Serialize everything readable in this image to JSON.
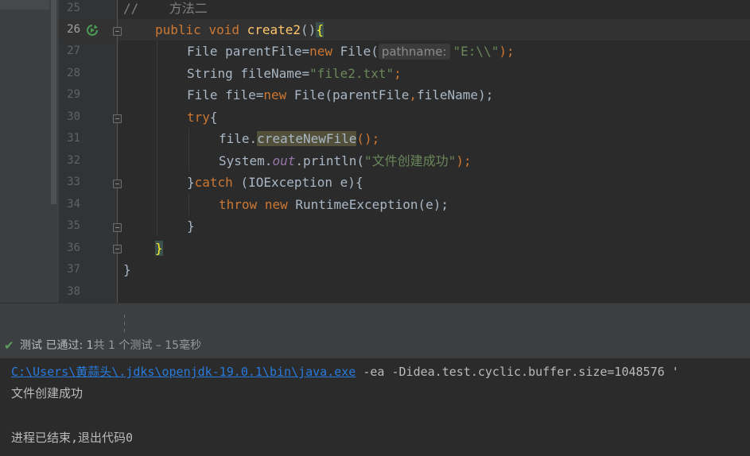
{
  "editor": {
    "lines": [
      {
        "num": "25",
        "comment": "//    方法二"
      },
      {
        "num": "26",
        "kw1": "public",
        "kw2": "void",
        "method": "create2",
        "parens": "()",
        "brace": "{"
      },
      {
        "num": "27",
        "t1": "File parentFile=",
        "kw": "new",
        "t2": " File(",
        "hint": "pathname:",
        "str": "\"E:\\\\\"",
        "t3": ");"
      },
      {
        "num": "28",
        "t1": "String fileName=",
        "str": "\"file2.txt\"",
        "t2": ";"
      },
      {
        "num": "29",
        "t1": "File file=",
        "kw": "new",
        "t2": " File(parentFile",
        "comma": ",",
        "t3": "fileName);"
      },
      {
        "num": "30",
        "kw": "try",
        "t1": "{"
      },
      {
        "num": "31",
        "t1": "file.",
        "hl": "createNewFile",
        "t2": "();"
      },
      {
        "num": "32",
        "t1": "System.",
        "static": "out",
        "t2": ".println(",
        "str": "\"文件创建成功\"",
        "t3": ");"
      },
      {
        "num": "33",
        "t1": "}",
        "kw": "catch",
        "t2": " (IOException e){"
      },
      {
        "num": "34",
        "kw1": "throw",
        "kw2": "new",
        "t1": " RuntimeException(e);"
      },
      {
        "num": "35",
        "t1": "}"
      },
      {
        "num": "36",
        "brace": "}"
      },
      {
        "num": "37",
        "t1": "}"
      },
      {
        "num": "38"
      }
    ]
  },
  "test_status": {
    "icon": "check-icon",
    "label": "测试 已通过: ",
    "count": "1",
    "detail": "共 1 个测试 – 15毫秒"
  },
  "console": {
    "path_link": "C:\\Users\\黄蒜头\\.jdks\\openjdk-19.0.1\\bin\\java.exe",
    "args": " -ea -Didea.test.cyclic.buffer.size=1048576 '",
    "output": "文件创建成功",
    "exit": "进程已结束,退出代码0"
  },
  "colors": {
    "background": "#2b2b2b",
    "keyword": "#cc7832",
    "string": "#6a8759",
    "method": "#ffc66d",
    "link": "#287bde",
    "success": "#5f9d61"
  }
}
